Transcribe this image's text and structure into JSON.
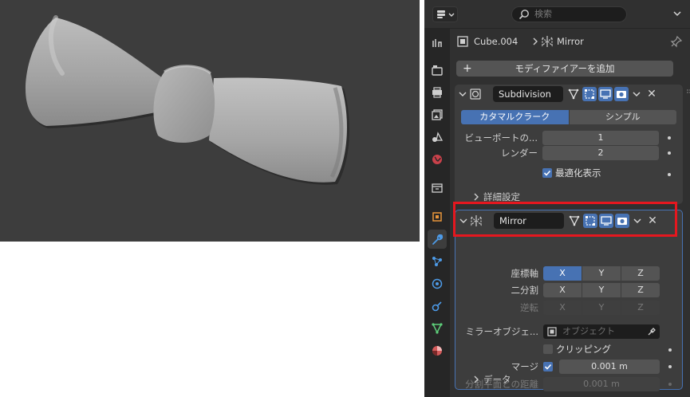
{
  "search": {
    "placeholder": "検索"
  },
  "breadcrumb": {
    "object": "Cube.004",
    "modifier": "Mirror"
  },
  "add_modifier_label": "モディファイアーを追加",
  "subdivision": {
    "name": "Subdivision",
    "modes": [
      "カタマルクラーク",
      "シンプル"
    ],
    "active_mode": 0,
    "viewport_label": "ビューポートの...",
    "viewport_value": "1",
    "render_label": "レンダー",
    "render_value": "2",
    "optimal_label": "最適化表示",
    "optimal_checked": true,
    "advanced_label": "詳細設定"
  },
  "mirror": {
    "name": "Mirror",
    "axis_label": "座標軸",
    "bisect_label": "二分割",
    "flip_label": "逆転",
    "axes": [
      "X",
      "Y",
      "Z"
    ],
    "mirror_object_label": "ミラーオブジェ...",
    "mirror_object_placeholder": "オブジェクト",
    "clipping_label": "クリッピング",
    "clipping_checked": false,
    "merge_label": "マージ",
    "merge_checked": true,
    "merge_value": "0.001 m",
    "bisect_distance_label": "分割平面との距離",
    "bisect_distance_value": "0.001 m",
    "data_label": "データ"
  },
  "colors": {
    "accent": "#4772b3",
    "highlight": "#e5171f",
    "panel": "#3d3d3d"
  }
}
